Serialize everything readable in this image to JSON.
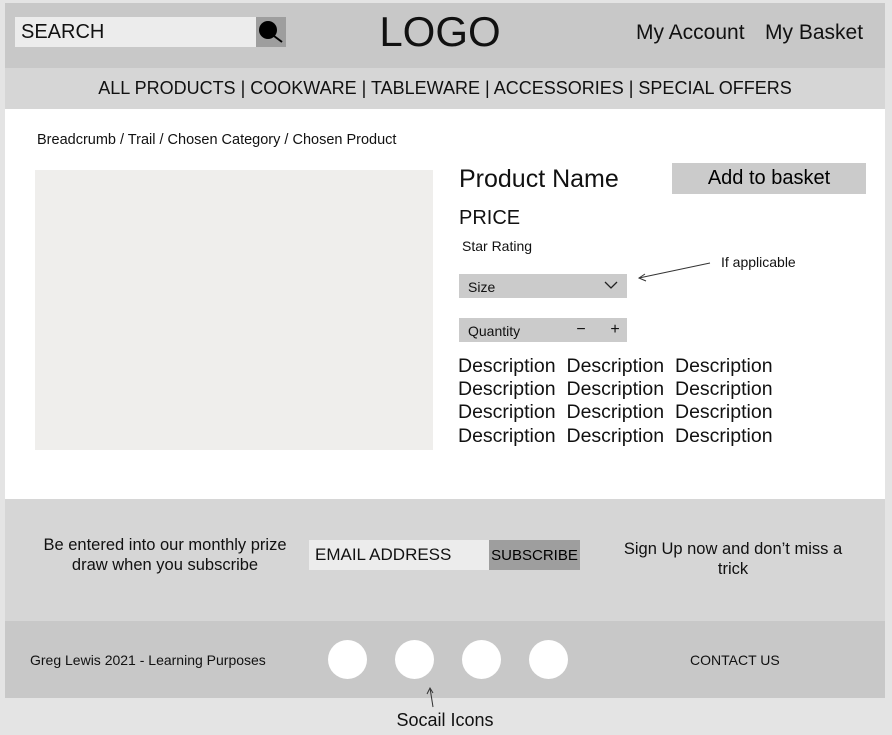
{
  "header": {
    "search_placeholder": "SEARCH",
    "logo": "LOGO",
    "my_account": "My Account",
    "my_basket": "My Basket"
  },
  "nav": {
    "items": [
      "ALL PRODUCTS",
      "COOKWARE",
      "TABLEWARE",
      "ACCESSORIES",
      "SPECIAL OFFERS"
    ],
    "separator": " | "
  },
  "breadcrumb": "Breadcrumb / Trail / Chosen Category / Chosen Product",
  "product": {
    "name": "Product Name",
    "add_to_basket": "Add to basket",
    "price": "PRICE",
    "star_rating": "Star Rating",
    "size_label": "Size",
    "size_annotation": "If applicable",
    "quantity_label": "Quantity",
    "qty_minus": "−",
    "qty_plus": "+",
    "description_rows": [
      [
        "Description",
        "Description",
        "Description"
      ],
      [
        "Description",
        "Description",
        "Description"
      ],
      [
        "Description",
        "Description",
        "Description"
      ],
      [
        "Description",
        "Description",
        "Description"
      ]
    ]
  },
  "newsletter": {
    "left_text": "Be entered into our monthly prize draw when you subscribe",
    "email_placeholder": "EMAIL ADDRESS",
    "subscribe_label": "SUBSCRIBE",
    "right_text": "Sign Up now and don’t miss a trick"
  },
  "footer": {
    "copyright": "Greg Lewis 2021 - Learning Purposes",
    "contact": "CONTACT US",
    "social_annotation": "Socail Icons"
  },
  "colors": {
    "header_bg": "#c8c8c8",
    "nav_bg": "#d6d6d6",
    "image_placeholder": "#efeeec",
    "button_dark": "#9e9e9e"
  }
}
